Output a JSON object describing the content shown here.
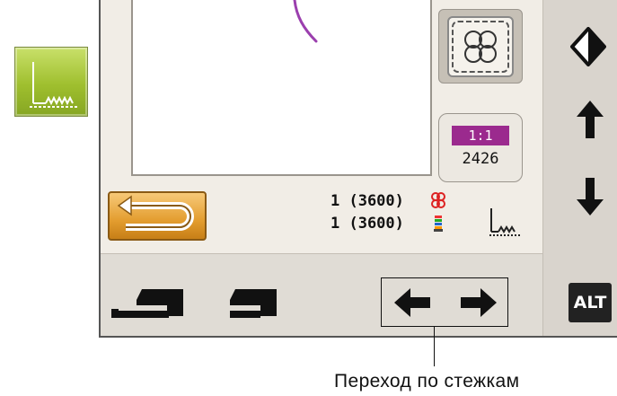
{
  "stitch_mode_button": {
    "icon": "stitch-line-icon"
  },
  "zoom": {
    "ratio": "1:1",
    "value": "2426"
  },
  "colors": {
    "ratio_bg": "#9b2a8e",
    "back_button": "#e39d2f",
    "stitch_button": "#9fbf2e"
  },
  "counters": [
    {
      "text": "1 (3600)",
      "icon": "color-block-icon"
    },
    {
      "text": "1 (3600)",
      "icon": "thread-spool-icon"
    }
  ],
  "right_strip": {
    "items": [
      {
        "name": "mirror-icon"
      },
      {
        "name": "arrow-up-icon"
      },
      {
        "name": "arrow-down-icon"
      }
    ],
    "alt_label": "ALT"
  },
  "bottom_bar": {
    "items": [
      {
        "name": "presser-foot-long-icon"
      },
      {
        "name": "presser-foot-short-icon"
      }
    ]
  },
  "annotation": {
    "caption": "Переход по стежкам"
  }
}
